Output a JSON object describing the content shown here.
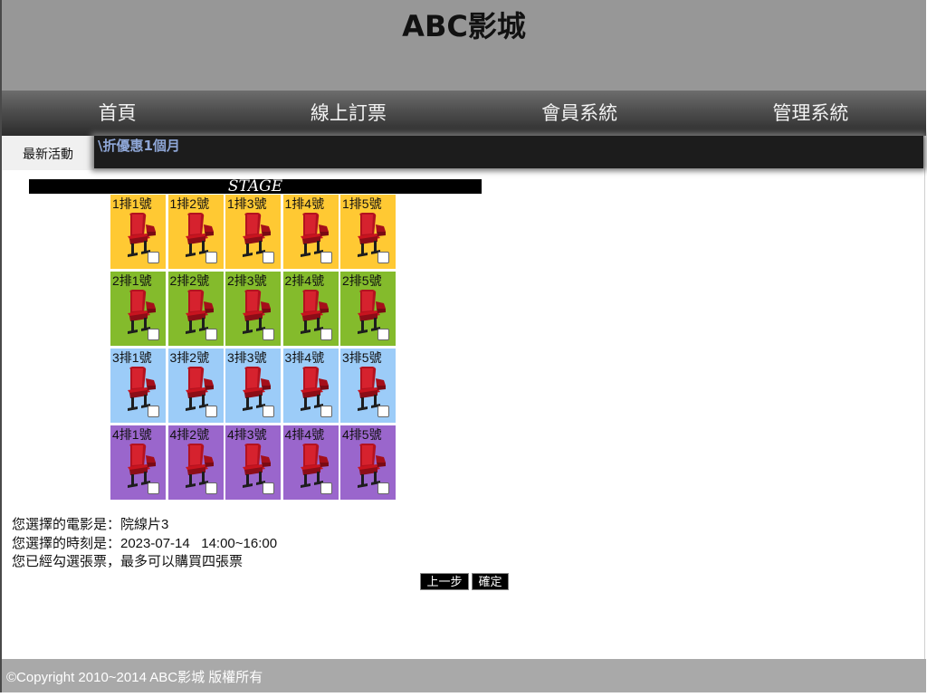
{
  "header": {
    "title": "ABC影城"
  },
  "nav": {
    "items": [
      {
        "label": "首頁"
      },
      {
        "label": "線上訂票"
      },
      {
        "label": "會員系統"
      },
      {
        "label": "管理系統"
      }
    ]
  },
  "news": {
    "tab_label": "最新活動",
    "marquee_text": "\\折優惠1個月"
  },
  "stage": {
    "label": "STAGE"
  },
  "seat_rows": [
    {
      "color": "#ffc933",
      "seats": [
        "1排1號",
        "1排2號",
        "1排3號",
        "1排4號",
        "1排5號"
      ]
    },
    {
      "color": "#84bb2c",
      "seats": [
        "2排1號",
        "2排2號",
        "2排3號",
        "2排4號",
        "2排5號"
      ]
    },
    {
      "color": "#9cccf8",
      "seats": [
        "3排1號",
        "3排2號",
        "3排3號",
        "3排4號",
        "3排5號"
      ]
    },
    {
      "color": "#9a66cc",
      "seats": [
        "4排1號",
        "4排2號",
        "4排3號",
        "4排4號",
        "4排5號"
      ]
    }
  ],
  "seat_icon": "red-chair-icon",
  "info": {
    "movie_line": "您選擇的電影是：院線片3",
    "time_line": "您選擇的時刻是：2023-07-14   14:00~16:00",
    "ticket_line": "您已經勾選張票，最多可以購買四張票"
  },
  "buttons": {
    "prev_label": "上一步",
    "confirm_label": "確定"
  },
  "footer": {
    "copyright": "©Copyright 2010~2014 ABC影城 版權所有"
  }
}
